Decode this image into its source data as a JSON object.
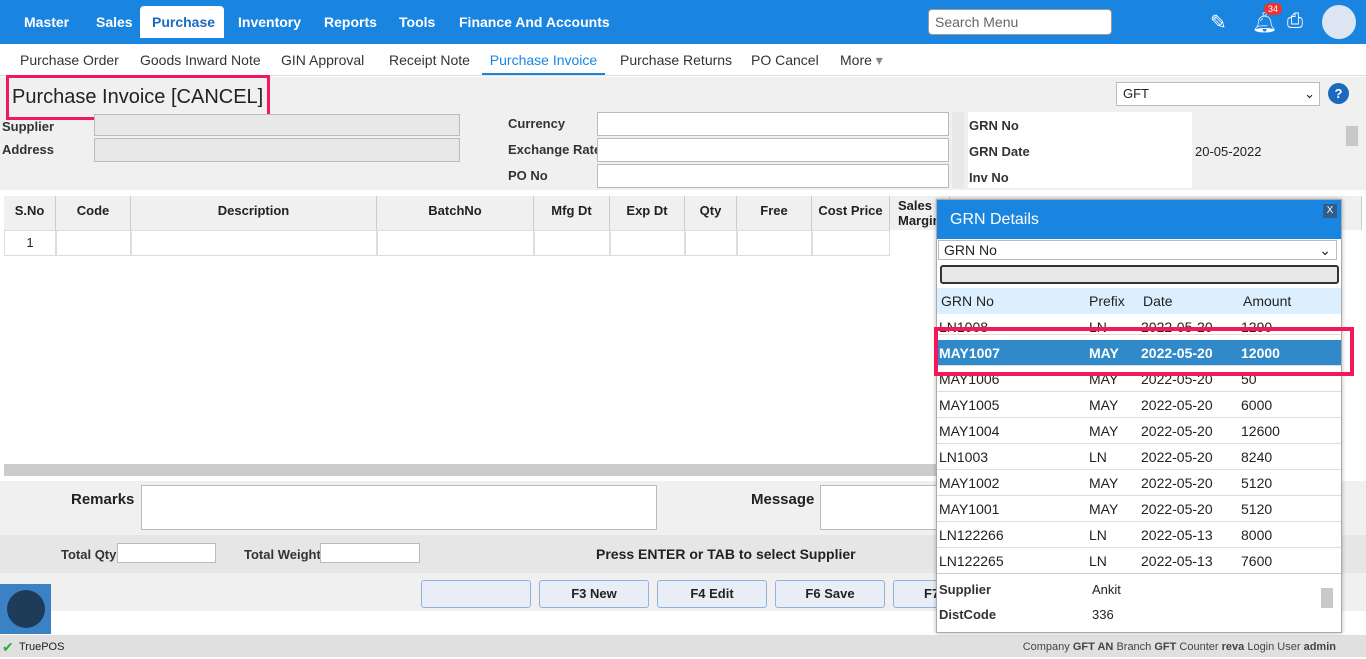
{
  "nav": {
    "items": [
      "Master",
      "Sales",
      "Purchase",
      "Inventory",
      "Reports",
      "Tools",
      "Finance And Accounts"
    ],
    "active": "Purchase",
    "search_placeholder": "Search Menu",
    "notification_count": "34"
  },
  "subnav": {
    "items": [
      "Purchase Order",
      "Goods Inward Note",
      "GIN Approval",
      "Receipt Note",
      "Purchase Invoice",
      "Purchase Returns",
      "PO Cancel",
      "More"
    ],
    "active": "Purchase Invoice"
  },
  "page": {
    "title": "Purchase Invoice [CANCEL]",
    "branch_select": "GFT"
  },
  "form": {
    "supplier_label": "Supplier",
    "address_label": "Address",
    "currency_label": "Currency",
    "exchange_rate_label": "Exchange Rate",
    "po_no_label": "PO No",
    "grn_no_label": "GRN No",
    "grn_date_label": "GRN Date",
    "grn_date_value": "20-05-2022",
    "inv_no_label": "Inv No"
  },
  "table": {
    "columns": [
      "S.No",
      "Code",
      "Description",
      "BatchNo",
      "Mfg Dt",
      "Exp Dt",
      "Qty",
      "Free",
      "Cost Price",
      "Sales Margin"
    ],
    "rows": [
      [
        "1"
      ]
    ]
  },
  "bottom": {
    "remarks_label": "Remarks",
    "message_label": "Message",
    "total_qty_label": "Total Qty",
    "total_weight_label": "Total Weight",
    "hint": "Press ENTER or TAB to select Supplier",
    "buttons": [
      "",
      "F3 New",
      "F4 Edit",
      "F6 Save",
      "F7"
    ]
  },
  "popup": {
    "title": "GRN Details",
    "close": "X",
    "filter_select": "GRN No",
    "columns": [
      "GRN No",
      "Prefix",
      "Date",
      "Amount"
    ],
    "rows": [
      [
        "LN1008",
        "LN",
        "2022-05-20",
        "1290"
      ],
      [
        "MAY1007",
        "MAY",
        "2022-05-20",
        "12000"
      ],
      [
        "MAY1006",
        "MAY",
        "2022-05-20",
        "50"
      ],
      [
        "MAY1005",
        "MAY",
        "2022-05-20",
        "6000"
      ],
      [
        "MAY1004",
        "MAY",
        "2022-05-20",
        "12600"
      ],
      [
        "LN1003",
        "LN",
        "2022-05-20",
        "8240"
      ],
      [
        "MAY1002",
        "MAY",
        "2022-05-20",
        "5120"
      ],
      [
        "MAY1001",
        "MAY",
        "2022-05-20",
        "5120"
      ],
      [
        "LN122266",
        "LN",
        "2022-05-13",
        "8000"
      ],
      [
        "LN122265",
        "LN",
        "2022-05-13",
        "7600"
      ]
    ],
    "details": [
      [
        "Supplier",
        "Ankit"
      ],
      [
        "DistCode",
        "336"
      ]
    ]
  },
  "status": {
    "app": "TruePOS",
    "company_label": "Company",
    "company": "GFT AN",
    "branch_label": "Branch",
    "branch": "GFT",
    "counter_label": "Counter",
    "counter": "reva",
    "user_label": "Login User",
    "user": "admin"
  }
}
